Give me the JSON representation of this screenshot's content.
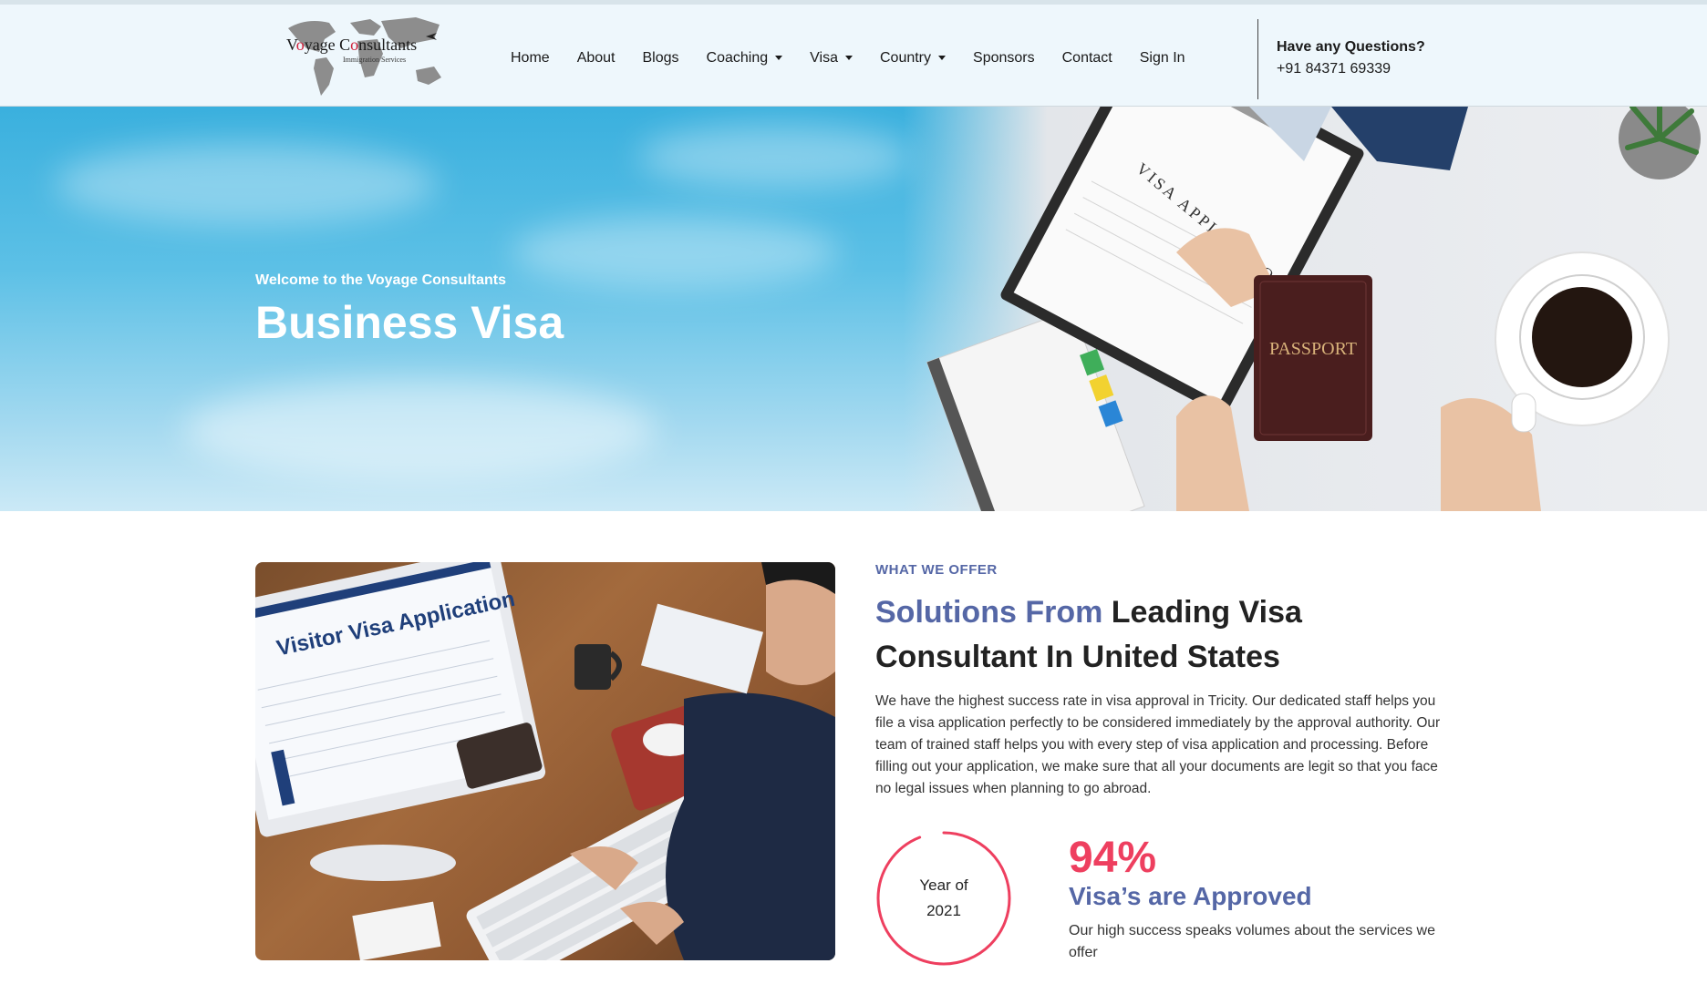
{
  "header": {
    "logo": {
      "name_before": "V",
      "name_o": "o",
      "name_mid": "yage C",
      "name_o2": "o",
      "name_after": "nsultants",
      "tagline": "Immigration Services"
    },
    "nav": [
      {
        "label": "Home",
        "dropdown": false
      },
      {
        "label": "About",
        "dropdown": false
      },
      {
        "label": "Blogs",
        "dropdown": false
      },
      {
        "label": "Coaching",
        "dropdown": true
      },
      {
        "label": "Visa",
        "dropdown": true
      },
      {
        "label": "Country",
        "dropdown": true
      },
      {
        "label": "Sponsors",
        "dropdown": false
      },
      {
        "label": "Contact",
        "dropdown": false
      },
      {
        "label": "Sign In",
        "dropdown": false
      }
    ],
    "contact": {
      "title": "Have any Questions?",
      "phone": "+91 84371 69339"
    }
  },
  "hero": {
    "subtitle": "Welcome to the Voyage Consultants",
    "title": "Business Visa",
    "image_text": {
      "form": "VISA APPLICATION",
      "passport": "PASSPORT"
    }
  },
  "offer": {
    "image_text": {
      "screen_title": "Visitor Visa Application"
    },
    "label": "WHAT WE OFFER",
    "title_accent": "Solutions From",
    "title_rest": " Leading Visa Consultant In United States",
    "body": "We have the highest success rate in visa approval in Tricity. Our dedicated staff helps you file a visa application perfectly to be considered immediately by the approval authority. Our team of trained staff helps you with every step of visa application and processing. Before filling out your application, we make sure that all your documents are legit so that you face no legal issues when planning to go abroad.",
    "ring": {
      "line1": "Year of",
      "line2": "2021",
      "progress": 0.94
    },
    "stat": {
      "value": "94%",
      "title": "Visa’s are Approved",
      "desc": "Our high success speaks volumes about the services we offer"
    }
  },
  "colors": {
    "accent": "#5567a6",
    "highlight": "#ee3f5f",
    "header_bg": "#eef7fc"
  }
}
